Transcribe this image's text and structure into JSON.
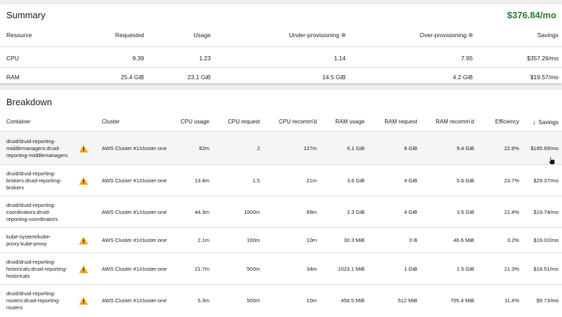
{
  "summary": {
    "title": "Summary",
    "total_savings": "$376.84/mo",
    "columns": [
      "Resource",
      "Requested",
      "Usage",
      "Under-provisioning",
      "Over-provisioning",
      "Savings"
    ],
    "rows": [
      {
        "resource": "CPU",
        "requested": "9.39",
        "usage": "1.23",
        "under": "1.14",
        "over": "7.95",
        "savings": "$357.26/mo"
      },
      {
        "resource": "RAM",
        "requested": "25.4 GiB",
        "usage": "23.1 GiB",
        "under": "14.5 GiB",
        "over": "4.2 GiB",
        "savings": "$19.57/mo"
      }
    ]
  },
  "breakdown": {
    "title": "Breakdown",
    "columns": {
      "container": "Container",
      "cluster": "Cluster",
      "cpu_usage": "CPU usage",
      "cpu_request": "CPU request",
      "cpu_recomm": "CPU recomm'd",
      "ram_usage": "RAM usage",
      "ram_request": "RAM request",
      "ram_recomm": "RAM recomm'd",
      "efficiency": "Efficiency",
      "savings": "Savings",
      "sort_icon": "arrow-down-icon"
    },
    "rows": [
      {
        "container": "druid/druid-reporting-middlemanagers:druid-reporting-middlemanagers",
        "warning": true,
        "cluster": "AWS Cluster #1/cluster-one",
        "cpu_usage": "82m",
        "cpu_request": "2",
        "cpu_recomm": "127m",
        "ram_usage": "6.1 GiB",
        "ram_request": "8 GiB",
        "ram_recomm": "9.4 GiB",
        "efficiency": "22.8%",
        "savings": "$185.99/mo"
      },
      {
        "container": "druid/druid-reporting-brokers:druid-reporting-brokers",
        "warning": true,
        "cluster": "AWS Cluster #1/cluster-one",
        "cpu_usage": "13.4m",
        "cpu_request": "1.5",
        "cpu_recomm": "21m",
        "ram_usage": "3.6 GiB",
        "ram_request": "4 GiB",
        "ram_recomm": "5.6 GiB",
        "efficiency": "23.7%",
        "savings": "$29.37/mo"
      },
      {
        "container": "druid/druid-reporting-coordinators:druid-reporting-coordinators",
        "warning": false,
        "cluster": "AWS Cluster #1/cluster-one",
        "cpu_usage": "44.3m",
        "cpu_request": "1000m",
        "cpu_recomm": "69m",
        "ram_usage": "2.3 GiB",
        "ram_request": "4 GiB",
        "ram_recomm": "3.5 GiB",
        "efficiency": "21.4%",
        "savings": "$19.74/mo"
      },
      {
        "container": "kube-system/kube-proxy:kube-proxy",
        "warning": true,
        "cluster": "AWS Cluster #1/cluster-one",
        "cpu_usage": "2.1m",
        "cpu_request": "100m",
        "cpu_recomm": "10m",
        "ram_usage": "30.3 MiB",
        "ram_request": "0 B",
        "ram_recomm": "46.6 MiB",
        "efficiency": "3.2%",
        "savings": "$19.02/mo"
      },
      {
        "container": "druid/druid-reporting-historicals:druid-reporting-historicals",
        "warning": true,
        "cluster": "AWS Cluster #1/cluster-one",
        "cpu_usage": "21.7m",
        "cpu_request": "500m",
        "cpu_recomm": "34m",
        "ram_usage": "1023.1 MiB",
        "ram_request": "1 GiB",
        "ram_recomm": "1.5 GiB",
        "efficiency": "21.3%",
        "savings": "$18.51/mo"
      },
      {
        "container": "druid/druid-reporting-routers:druid-reporting-routers",
        "warning": true,
        "cluster": "AWS Cluster #1/cluster-one",
        "cpu_usage": "5.3m",
        "cpu_request": "500m",
        "cpu_recomm": "10m",
        "ram_usage": "458.5 MiB",
        "ram_request": "512 MiB",
        "ram_recomm": "705.4 MiB",
        "efficiency": "11.4%",
        "savings": "$9.73/mo"
      }
    ]
  },
  "colors": {
    "savings_green": "#2e7d32",
    "warning_yellow": "#f9a825",
    "highlight_row": "#f5f5f5"
  }
}
